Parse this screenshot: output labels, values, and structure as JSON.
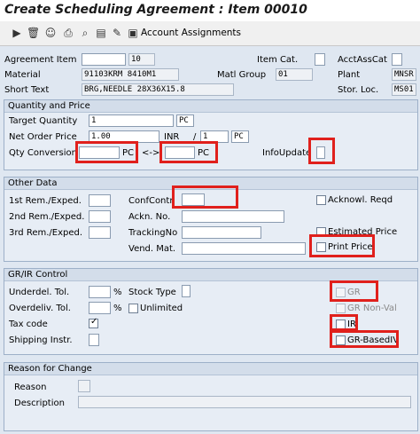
{
  "title": "Create Scheduling Agreement : Item 00010",
  "toolbar": {
    "icons": [
      "execute-icon",
      "delete-icon",
      "partner-icon",
      "print-icon",
      "search-icon",
      "document-icon",
      "edit-icon",
      "folder-icon",
      "account-assignment-icon"
    ],
    "account_label": "Account Assignments"
  },
  "header": {
    "agreement_item_label": "Agreement Item",
    "agreement_item_value": "",
    "item_no": "10",
    "item_cat_label": "Item Cat.",
    "acct_ass_cat_label": "AcctAssCat",
    "material_label": "Material",
    "material_value": "91103KRM 8410M1",
    "matl_group_label": "Matl Group",
    "matl_group_value": "01",
    "plant_label": "Plant",
    "plant_value": "MNSR",
    "short_text_label": "Short Text",
    "short_text_value": "BRG,NEEDLE 28X36X15.8",
    "stor_loc_label": "Stor. Loc.",
    "stor_loc_value": "MS01"
  },
  "qty_price": {
    "section_title": "Quantity and Price",
    "target_qty_label": "Target Quantity",
    "target_qty_value": "1",
    "target_qty_unit": "PC",
    "net_price_label": "Net Order Price",
    "net_price_value": "1.00",
    "currency": "INR",
    "slash": "/",
    "per_value": "1",
    "per_unit": "PC",
    "qty_conv_label": "Qty Conversion",
    "conv_unit_1": "PC",
    "arrow": "<->",
    "conv_unit_2": "PC",
    "info_update_label": "InfoUpdate"
  },
  "other_data": {
    "section_title": "Other Data",
    "rem1_label": "1st Rem./Exped.",
    "rem2_label": "2nd Rem./Exped.",
    "rem3_label": "3rd Rem./Exped.",
    "conf_ctrl_label": "ConfContr",
    "ackn_no_label": "Ackn. No.",
    "tracking_no_label": "TrackingNo",
    "vend_mat_label": "Vend. Mat.",
    "acknowl_reqd_label": "Acknowl. Reqd",
    "estimated_price_label": "Estimated Price",
    "print_price_label": "Print Price"
  },
  "grir": {
    "section_title": "GR/IR Control",
    "underdel_label": "Underdel. Tol.",
    "overdeliv_label": "Overdeliv. Tol.",
    "percent": "%",
    "unlimited_label": "Unlimited",
    "stock_type_label": "Stock Type",
    "tax_code_label": "Tax code",
    "shipping_label": "Shipping Instr.",
    "gr_label": "GR",
    "gr_nonval_label": "GR Non-Val",
    "ir_label": "IR",
    "gr_based_iv_label": "GR-BasedIV"
  },
  "reason": {
    "section_title": "Reason for Change",
    "reason_label": "Reason",
    "description_label": "Description"
  },
  "colors": {
    "highlight": "#e0201c",
    "panel": "#e7edf5",
    "header": "#d3ddea"
  }
}
